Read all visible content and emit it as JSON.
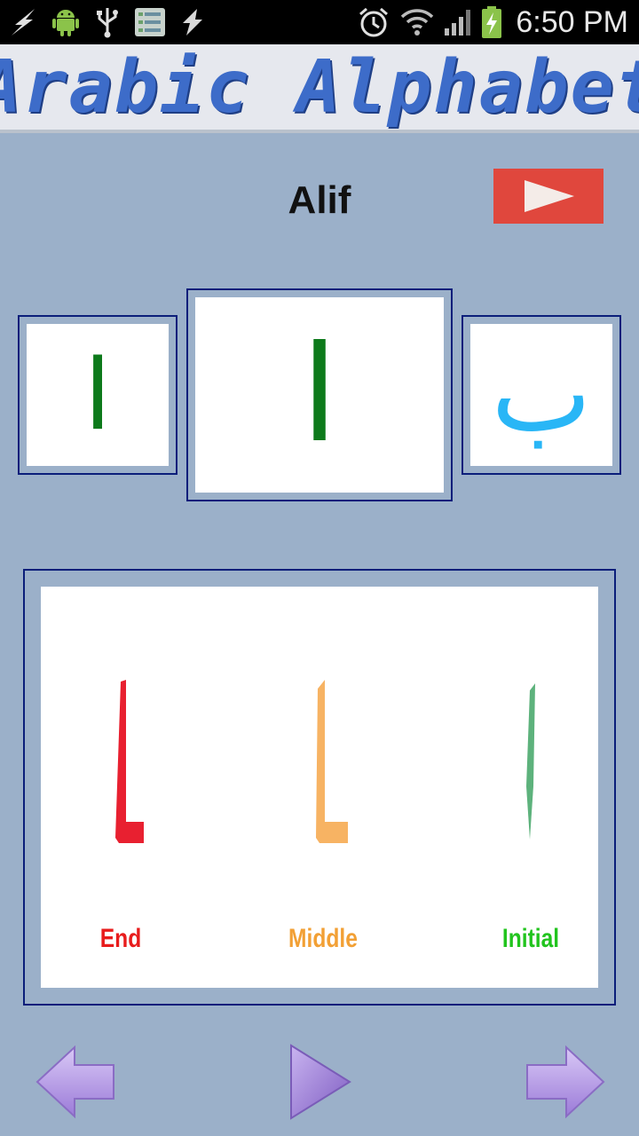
{
  "status_bar": {
    "time": "6:50 PM",
    "icons": [
      "flash-icon",
      "android-icon",
      "usb-icon",
      "settings-list-icon",
      "sync-icon",
      "alarm-icon",
      "wifi-icon",
      "signal-icon",
      "battery-charging-icon"
    ]
  },
  "banner": {
    "title": "Arabic Alphabet"
  },
  "lesson": {
    "letter_name": "Alif",
    "previous_letter_glyph": "ا",
    "current_letter_glyph": "ا",
    "next_letter_glyph": "ب"
  },
  "forms": [
    {
      "label": "End",
      "glyph": "ـا",
      "color": "#e82030"
    },
    {
      "label": "Middle",
      "glyph": "ـا",
      "color": "#f7a84a"
    },
    {
      "label": "Initial",
      "glyph": "ا",
      "color": "#5db27c"
    }
  ],
  "form_label_colors": {
    "end": "#e81c1c",
    "middle": "#f2a035",
    "initial": "#22c41e"
  },
  "colors": {
    "background": "#9bb0c9",
    "frame_border": "#0b1e7a",
    "banner_text": "#3d6cc9",
    "play_button": "#e0473d",
    "nav_arrow": "#b59be6",
    "prev_glyph": "#0d7a1b",
    "next_glyph": "#29b6f6"
  }
}
